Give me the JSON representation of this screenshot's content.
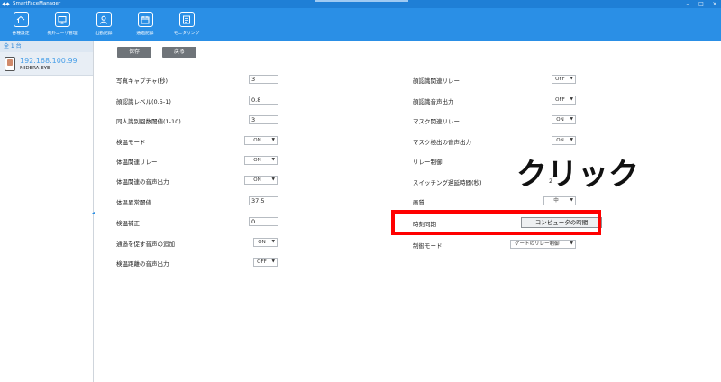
{
  "app": {
    "title": "SmartFaceManager"
  },
  "window_controls": {
    "minimize": "–",
    "restore": "□",
    "close": "×"
  },
  "toolbar": [
    {
      "label": "各種設定",
      "icon": "home-icon"
    },
    {
      "label": "例外ユーザ管理",
      "icon": "monitor-icon"
    },
    {
      "label": "出勤記録",
      "icon": "person-icon"
    },
    {
      "label": "通過記録",
      "icon": "calendar-icon"
    },
    {
      "label": "モニタリング",
      "icon": "list-icon"
    }
  ],
  "sidebar": {
    "count_label": "全 1 台",
    "device": {
      "ip": "192.168.100.99",
      "name": "MIDERA EYE"
    }
  },
  "buttons": {
    "save": "保存",
    "back": "戻る"
  },
  "settings_left": [
    {
      "label": "写真キャプチャ(秒)",
      "type": "input",
      "value": "3"
    },
    {
      "label": "顔認識レベル(0.5-1)",
      "type": "input",
      "value": "0.8"
    },
    {
      "label": "同人識別回数閾値(1-10)",
      "type": "input",
      "value": "3"
    },
    {
      "label": "検温モード",
      "type": "select",
      "value": "ON"
    },
    {
      "label": "体温関連リレー",
      "type": "select",
      "value": "ON"
    },
    {
      "label": "体温関連の音声出力",
      "type": "select",
      "value": "ON"
    },
    {
      "label": "体温異常閾値",
      "type": "input",
      "value": "37.5"
    },
    {
      "label": "検温補正",
      "type": "input",
      "value": "0"
    },
    {
      "label": "通過を促す音声の追加",
      "type": "select",
      "value": "ON"
    },
    {
      "label": "検温距離の音声出力",
      "type": "select",
      "value": "OFF"
    }
  ],
  "settings_right": [
    {
      "label": "顔認識関連リレー",
      "type": "select",
      "value": "OFF"
    },
    {
      "label": "顔認識音声出力",
      "type": "select",
      "value": "OFF"
    },
    {
      "label": "マスク関連リレー",
      "type": "select",
      "value": "ON"
    },
    {
      "label": "マスク検出の音声出力",
      "type": "select",
      "value": "ON"
    },
    {
      "label": "リレー制御",
      "type": "text",
      "value": ""
    },
    {
      "label": "スイッチング遅延時間(秒)",
      "type": "text",
      "value": "2"
    },
    {
      "label": "画質",
      "type": "select",
      "value": "中"
    },
    {
      "label": "時刻同期",
      "type": "button",
      "value": "コンピュータの時間"
    },
    {
      "label": "制御モード",
      "type": "select",
      "value": "ゲートのリレー制御"
    }
  ],
  "annotation": {
    "callout": "クリック",
    "highlight_color": "#ff0000"
  },
  "colors": {
    "accent": "#2a8fe6",
    "titlebar": "#1f7fd6"
  }
}
